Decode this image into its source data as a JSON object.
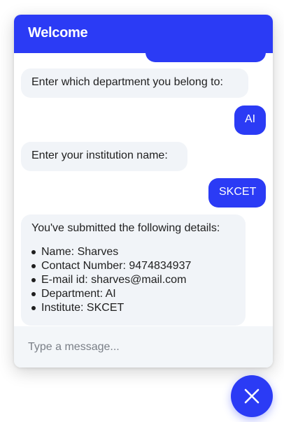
{
  "header": {
    "title": "Welcome"
  },
  "messages": [
    {
      "sender": "user",
      "text": ""
    },
    {
      "sender": "bot",
      "text": "Enter which department you belong to:"
    },
    {
      "sender": "user",
      "text": "AI"
    },
    {
      "sender": "bot",
      "text": "Enter your institution name:"
    },
    {
      "sender": "user",
      "text": "SKCET"
    },
    {
      "sender": "bot",
      "text": "You've submitted the following details:",
      "details": [
        "Name: Sharves",
        "Contact Number: 9474834937",
        "E-mail id: sharves@mail.com",
        "Department: AI",
        "Institute: SKCET"
      ]
    }
  ],
  "composer": {
    "placeholder": "Type a message..."
  },
  "launcher": {
    "icon": "close-icon"
  },
  "colors": {
    "accent": "#2b3bf5",
    "bot_bubble": "#f1f4f8",
    "input_bg": "#f3f6f9"
  }
}
